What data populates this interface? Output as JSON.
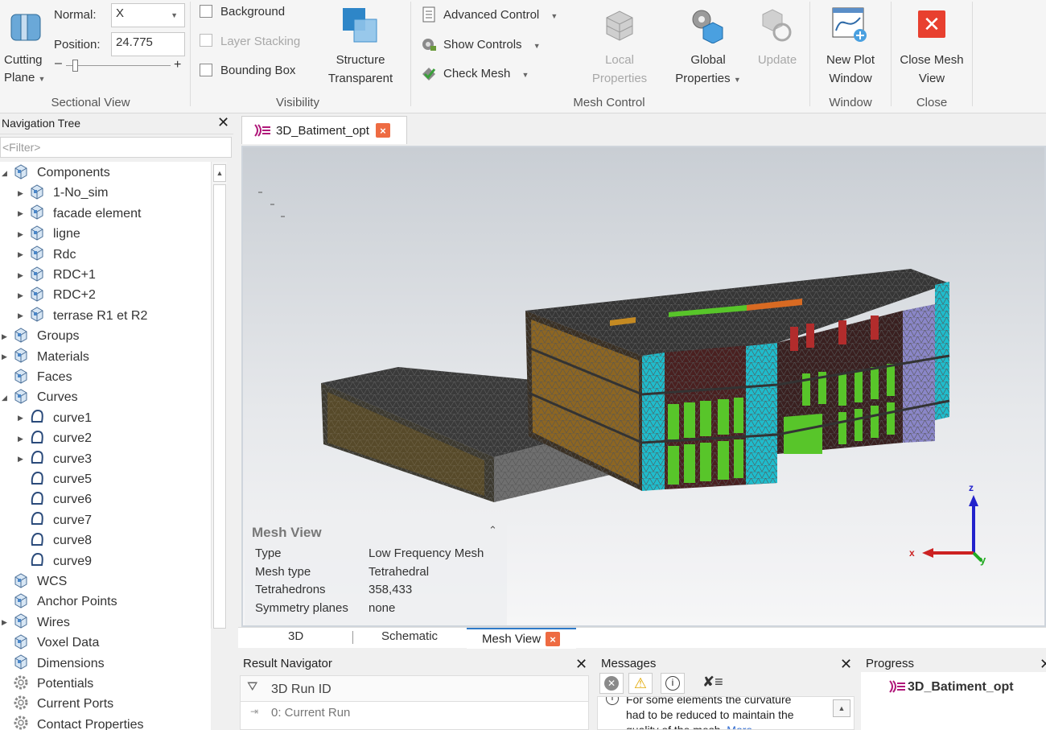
{
  "ribbon": {
    "sectional": {
      "normal_label": "Normal:",
      "normal_value": "X",
      "position_label": "Position:",
      "position_value": "24.775",
      "cutting_plane": [
        "Cutting",
        "Plane"
      ],
      "slider_minus": "–",
      "slider_plus": "+",
      "group_label": "Sectional View"
    },
    "visibility": {
      "background": "Background",
      "layer_stacking": "Layer Stacking",
      "bounding_box": "Bounding Box",
      "structure_transparent": [
        "Structure",
        "Transparent"
      ],
      "group_label": "Visibility"
    },
    "mesh_control": {
      "advanced_control": "Advanced Control",
      "show_controls": "Show Controls",
      "check_mesh": "Check Mesh",
      "local_properties": [
        "Local",
        "Properties"
      ],
      "global_properties": [
        "Global",
        "Properties"
      ],
      "update": "Update",
      "group_label": "Mesh Control"
    },
    "window": {
      "new_plot": [
        "New Plot",
        "Window"
      ],
      "group_label": "Window"
    },
    "close": {
      "close_mesh": [
        "Close Mesh",
        "View"
      ],
      "group_label": "Close"
    }
  },
  "nav": {
    "title": "Navigation Tree",
    "filter": "<Filter>",
    "items": [
      {
        "label": "Components",
        "level": 0,
        "toggle": "expanded",
        "icon": "component-icon"
      },
      {
        "label": "1-No_sim",
        "level": 1,
        "toggle": "collapsed",
        "icon": "component-icon"
      },
      {
        "label": "facade element",
        "level": 1,
        "toggle": "collapsed",
        "icon": "component-icon"
      },
      {
        "label": "ligne",
        "level": 1,
        "toggle": "collapsed",
        "icon": "component-icon"
      },
      {
        "label": "Rdc",
        "level": 1,
        "toggle": "collapsed",
        "icon": "component-icon"
      },
      {
        "label": "RDC+1",
        "level": 1,
        "toggle": "collapsed",
        "icon": "component-icon"
      },
      {
        "label": "RDC+2",
        "level": 1,
        "toggle": "collapsed",
        "icon": "component-icon"
      },
      {
        "label": "terrase R1 et R2",
        "level": 1,
        "toggle": "collapsed",
        "icon": "component-icon"
      },
      {
        "label": "Groups",
        "level": 0,
        "toggle": "collapsed",
        "icon": "component-icon"
      },
      {
        "label": "Materials",
        "level": 0,
        "toggle": "collapsed",
        "icon": "component-icon"
      },
      {
        "label": "Faces",
        "level": 0,
        "toggle": "none",
        "icon": "component-icon"
      },
      {
        "label": "Curves",
        "level": 0,
        "toggle": "expanded",
        "icon": "component-icon"
      },
      {
        "label": "curve1",
        "level": 1,
        "toggle": "collapsed",
        "icon": "curve-icon"
      },
      {
        "label": "curve2",
        "level": 1,
        "toggle": "collapsed",
        "icon": "curve-icon"
      },
      {
        "label": "curve3",
        "level": 1,
        "toggle": "collapsed",
        "icon": "curve-icon"
      },
      {
        "label": "curve5",
        "level": 1,
        "toggle": "none",
        "icon": "curve-icon"
      },
      {
        "label": "curve6",
        "level": 1,
        "toggle": "none",
        "icon": "curve-icon"
      },
      {
        "label": "curve7",
        "level": 1,
        "toggle": "none",
        "icon": "curve-icon"
      },
      {
        "label": "curve8",
        "level": 1,
        "toggle": "none",
        "icon": "curve-icon"
      },
      {
        "label": "curve9",
        "level": 1,
        "toggle": "none",
        "icon": "curve-icon"
      },
      {
        "label": "WCS",
        "level": 0,
        "toggle": "none",
        "icon": "component-icon"
      },
      {
        "label": "Anchor Points",
        "level": 0,
        "toggle": "none",
        "icon": "component-icon"
      },
      {
        "label": "Wires",
        "level": 0,
        "toggle": "collapsed",
        "icon": "component-icon"
      },
      {
        "label": "Voxel Data",
        "level": 0,
        "toggle": "none",
        "icon": "component-icon"
      },
      {
        "label": "Dimensions",
        "level": 0,
        "toggle": "none",
        "icon": "component-icon"
      },
      {
        "label": "Potentials",
        "level": 0,
        "toggle": "none",
        "icon": "gear-icon"
      },
      {
        "label": "Current Ports",
        "level": 0,
        "toggle": "none",
        "icon": "gear-icon"
      },
      {
        "label": "Contact Properties",
        "level": 0,
        "toggle": "none",
        "icon": "gear-icon"
      }
    ]
  },
  "document": {
    "tab_label": "3D_Batiment_opt",
    "close_glyph": "×"
  },
  "mesh_view": {
    "title": "Mesh View",
    "rows": [
      {
        "key": "Type",
        "value": "Low Frequency Mesh"
      },
      {
        "key": "Mesh type",
        "value": "Tetrahedral"
      },
      {
        "key": "Tetrahedrons",
        "value": "358,433"
      },
      {
        "key": "Symmetry planes",
        "value": "none"
      }
    ]
  },
  "axes": {
    "z": "z",
    "x": "x",
    "y": "y"
  },
  "bottom_tabs": [
    "3D",
    "Schematic",
    "Mesh View"
  ],
  "result_navigator": {
    "title": "Result Navigator",
    "column": "3D Run ID",
    "row": "0: Current Run"
  },
  "messages": {
    "title": "Messages",
    "text_lines": [
      "For some elements the curvature",
      "had to be reduced to maintain the",
      "quality of the mesh."
    ],
    "more_link": "More..."
  },
  "progress": {
    "title": "Progress",
    "item": "3D_Batiment_opt"
  },
  "colors": {
    "accent_close": "#e8402f",
    "tab_close": "#ee6b42",
    "mesh_dark": "#3a3a3a",
    "cyan": "#1fbccc",
    "green": "#58c52a",
    "orange": "#c58a22",
    "purple": "#8a86c8",
    "maroon": "#6b1515"
  }
}
